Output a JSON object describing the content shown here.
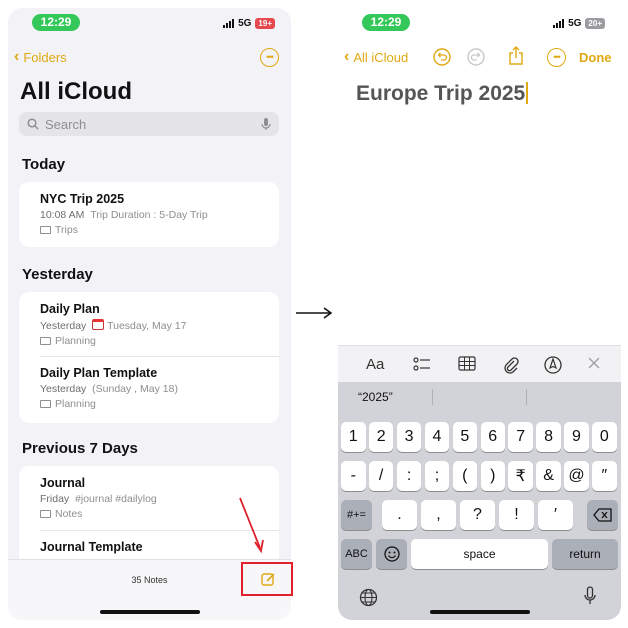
{
  "left": {
    "status": {
      "time": "12:29",
      "network": "5G",
      "battery": "19+"
    },
    "nav": {
      "back_label": "Folders"
    },
    "title": "All iCloud",
    "search": {
      "placeholder": "Search"
    },
    "sections": [
      {
        "header": "Today",
        "notes": [
          {
            "title": "NYC Trip 2025",
            "time": "10:08 AM",
            "preview": "Trip Duration : 5-Day Trip",
            "folder": "Trips"
          }
        ]
      },
      {
        "header": "Yesterday",
        "notes": [
          {
            "title": "Daily Plan",
            "time": "Yesterday",
            "preview": "Tuesday, May 17",
            "folder": "Planning"
          },
          {
            "title": "Daily Plan Template",
            "time": "Yesterday",
            "preview": "(Sunday , May 18)",
            "folder": "Planning"
          }
        ]
      },
      {
        "header": "Previous 7 Days",
        "notes": [
          {
            "title": "Journal",
            "time": "Friday",
            "preview": "#journal #dailylog",
            "folder": "Notes"
          },
          {
            "title": "Journal Template",
            "time": "",
            "preview": "",
            "folder": ""
          }
        ]
      }
    ],
    "bottom": {
      "count": "35 Notes"
    }
  },
  "right": {
    "status": {
      "time": "12:29",
      "network": "5G",
      "battery": "20+"
    },
    "nav": {
      "back_label": "All iCloud",
      "done_label": "Done"
    },
    "note_title": "Europe Trip 2025",
    "format_bar": {
      "aa": "Aa"
    },
    "suggestion": "“2025”",
    "keyboard": {
      "row1": [
        "1",
        "2",
        "3",
        "4",
        "5",
        "6",
        "7",
        "8",
        "9",
        "0"
      ],
      "row2": [
        "-",
        "/",
        ":",
        ";",
        "(",
        ")",
        "₹",
        "&",
        "@",
        "″"
      ],
      "row3": [
        ".",
        ",",
        "?",
        "!",
        "′"
      ],
      "shift": "#+=",
      "abc": "ABC",
      "space": "space",
      "return": "return"
    }
  },
  "colors": {
    "accent": "#e0a812",
    "highlight": "#e0202a",
    "status_pill": "#34c759"
  }
}
